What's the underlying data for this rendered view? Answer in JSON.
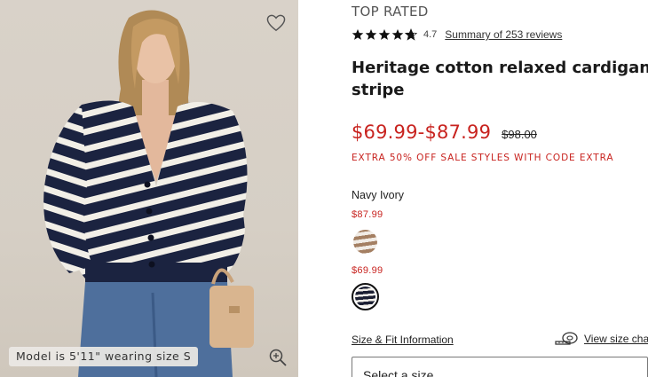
{
  "product_image": {
    "caption": "Model is 5'11\" wearing size S",
    "icons": {
      "wishlist": "heart-outline-icon",
      "zoom": "zoom-in-icon"
    }
  },
  "details": {
    "badge": "TOP RATED",
    "rating": {
      "stars": 4.7,
      "value_text": "4.7",
      "reviews_link": "Summary of 253 reviews"
    },
    "title_lines": [
      "Heritage cotton relaxed cardigan in",
      "stripe"
    ],
    "sale_price": "$69.99-$87.99",
    "original_price": "$98.00",
    "promo": "EXTRA 50% OFF SALE STYLES WITH CODE EXTRA",
    "selected_color": "Navy Ivory",
    "variants": [
      {
        "price": "$87.99",
        "swatch": "brown-ivory-stripe"
      },
      {
        "price": "$69.99",
        "swatch": "navy-ivory-stripe",
        "selected": true
      }
    ],
    "size_fit_link": "Size & Fit Information",
    "size_chart_link": "View size chart",
    "size_select_placeholder": "Select a size"
  },
  "colors": {
    "sale_red": "#c8231f",
    "navy": "#1b1f33",
    "ivory": "#f4f1ea"
  }
}
